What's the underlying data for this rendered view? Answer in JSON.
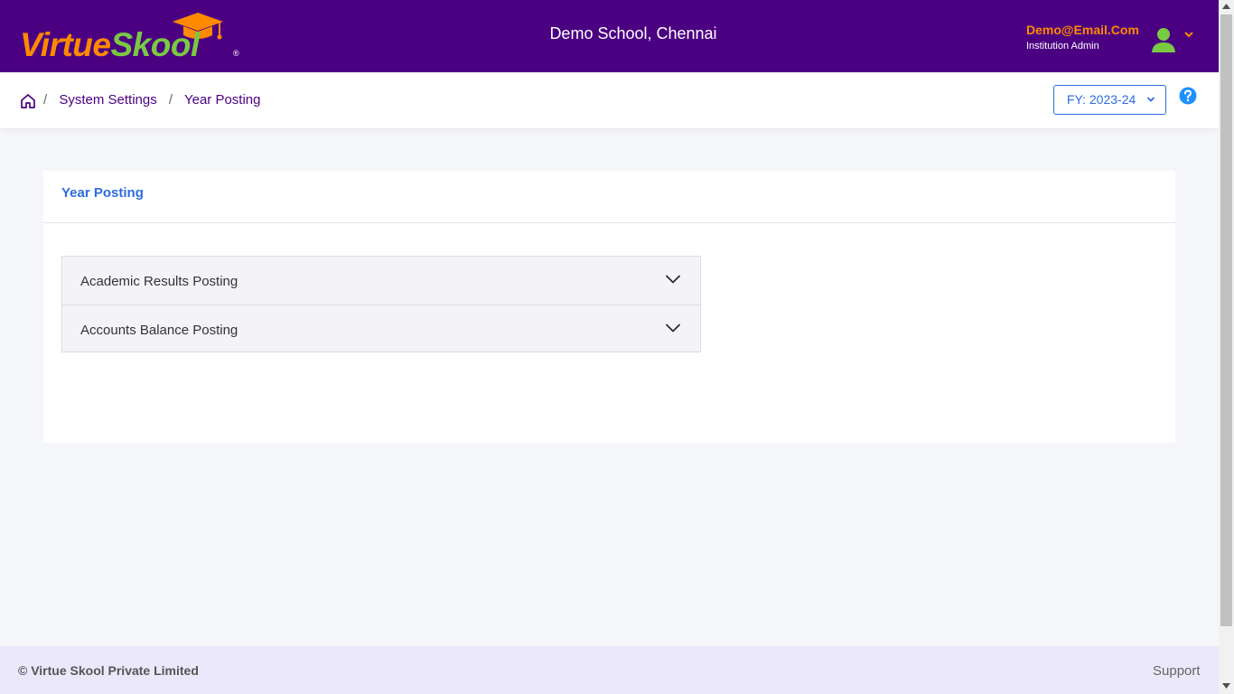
{
  "header": {
    "logo": {
      "part1": "Virtue",
      "part2": "Skool",
      "reg": "®"
    },
    "school_name": "Demo School, Chennai",
    "user": {
      "email": "Demo@Email.Com",
      "role": "Institution Admin"
    }
  },
  "breadcrumb": {
    "separator": "/",
    "items": [
      "System Settings",
      "Year Posting"
    ]
  },
  "fy_selector": {
    "value": "FY: 2023-24"
  },
  "card": {
    "title": "Year Posting",
    "accordion": [
      {
        "label": "Academic Results Posting"
      },
      {
        "label": "Accounts Balance Posting"
      }
    ]
  },
  "footer": {
    "copyright": "© Virtue Skool Private Limited",
    "support": "Support"
  },
  "colors": {
    "header_bg": "#4b0082",
    "accent_orange": "#ff8a00",
    "accent_green": "#7ac943",
    "link_blue": "#2d6cdf",
    "footer_bg": "#ece8fb"
  },
  "icons": {
    "home": "home-icon",
    "help": "help-icon",
    "avatar": "user-avatar-icon",
    "caret": "chevron-down-icon"
  }
}
